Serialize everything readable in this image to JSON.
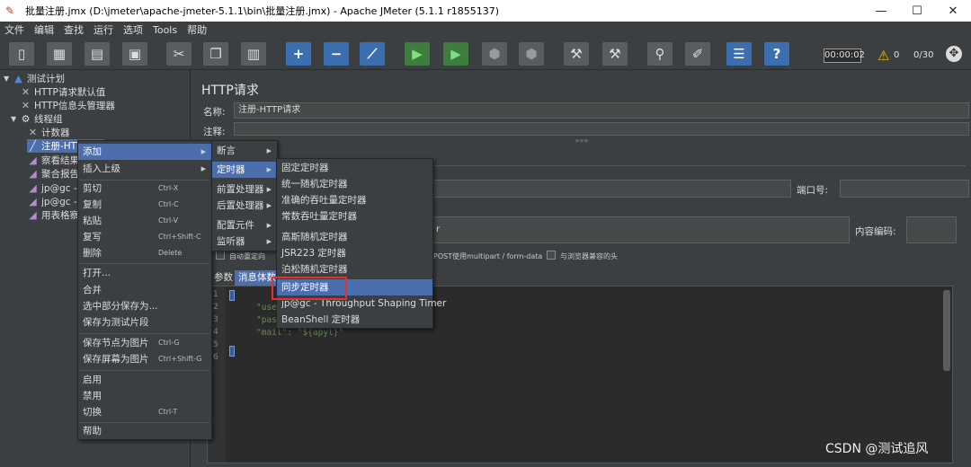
{
  "window": {
    "title": "批量注册.jmx (D:\\jmeter\\apache-jmeter-5.1.1\\bin\\批量注册.jmx) - Apache JMeter (5.1.1 r1855137)",
    "controls": [
      "—",
      "☐",
      "✕"
    ]
  },
  "menubar": [
    "文件",
    "编辑",
    "查找",
    "运行",
    "选项",
    "Tools",
    "帮助"
  ],
  "toolbar": {
    "elapsed_time": "00:00:02",
    "warning_count": "0",
    "thread_count": "0/30"
  },
  "tree": {
    "items": [
      {
        "label": "测试计划"
      },
      {
        "label": "HTTP请求默认值"
      },
      {
        "label": "HTTP信息头管理器"
      },
      {
        "label": "线程组"
      },
      {
        "label": "计数器"
      },
      {
        "label": "注册-HTTP"
      },
      {
        "label": "察看结果"
      },
      {
        "label": "聚合报告"
      },
      {
        "label": "jp@gc - T"
      },
      {
        "label": "jp@gc - A"
      },
      {
        "label": "用表格察"
      }
    ]
  },
  "panel": {
    "title": "HTTP请求",
    "name_label": "名称:",
    "name_value": "注册-HTTP请求",
    "comment_label": "注释:",
    "splitter_glyph": "»»»",
    "port_label": "端口号:",
    "encoding_label": "内容编码:",
    "field_fragment": "r",
    "checkboxes": {
      "auto_redirect": "自动重定向",
      "multipart": "POST使用multipart / form-data",
      "browser_headers": "与浏览器兼容的头"
    },
    "tabs": {
      "params": "参数",
      "body": "消息体数"
    },
    "editor": {
      "line_numbers": [
        "1",
        "2",
        "3",
        "4",
        "5",
        "6"
      ],
      "lines": [
        "\"use",
        "\"pas",
        "\"mail\": \"${apyl}\""
      ]
    }
  },
  "context_menu_main": {
    "items": [
      {
        "label": "添加",
        "shortcut": ""
      },
      {
        "label": "插入上级",
        "shortcut": ""
      },
      {
        "label": "剪切",
        "shortcut": "Ctrl-X"
      },
      {
        "label": "复制",
        "shortcut": "Ctrl-C"
      },
      {
        "label": "粘贴",
        "shortcut": "Ctrl-V"
      },
      {
        "label": "复写",
        "shortcut": "Ctrl+Shift-C"
      },
      {
        "label": "删除",
        "shortcut": "Delete"
      },
      {
        "label": "打开...",
        "shortcut": ""
      },
      {
        "label": "合并",
        "shortcut": ""
      },
      {
        "label": "选中部分保存为...",
        "shortcut": ""
      },
      {
        "label": "保存为测试片段",
        "shortcut": ""
      },
      {
        "label": "保存节点为图片",
        "shortcut": "Ctrl-G"
      },
      {
        "label": "保存屏幕为图片",
        "shortcut": "Ctrl+Shift-G"
      },
      {
        "label": "启用",
        "shortcut": ""
      },
      {
        "label": "禁用",
        "shortcut": ""
      },
      {
        "label": "切换",
        "shortcut": "Ctrl-T"
      },
      {
        "label": "帮助",
        "shortcut": ""
      }
    ]
  },
  "context_menu_add": {
    "items": [
      {
        "label": "断言"
      },
      {
        "label": "定时器"
      },
      {
        "label": "前置处理器"
      },
      {
        "label": "后置处理器"
      },
      {
        "label": "配置元件"
      },
      {
        "label": "监听器"
      }
    ]
  },
  "context_menu_timer": {
    "items": [
      {
        "label": "固定定时器"
      },
      {
        "label": "统一随机定时器"
      },
      {
        "label": "准确的吞吐量定时器"
      },
      {
        "label": "常数吞吐量定时器"
      },
      {
        "label": "高斯随机定时器"
      },
      {
        "label": "JSR223 定时器"
      },
      {
        "label": "泊松随机定时器"
      },
      {
        "label": "同步定时器"
      },
      {
        "label": "jp@gc - Throughput Shaping Timer"
      },
      {
        "label": "BeanShell 定时器"
      }
    ]
  },
  "watermark": "CSDN @测试追风"
}
